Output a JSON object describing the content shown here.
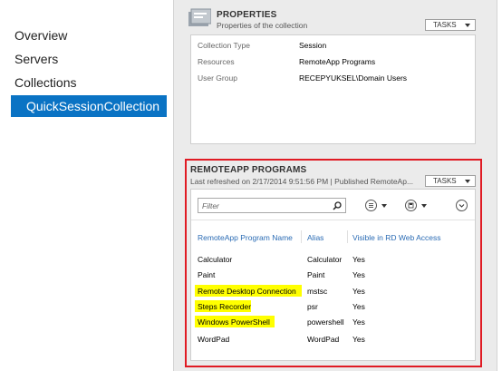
{
  "nav": {
    "items": [
      "Overview",
      "Servers",
      "Collections",
      "QuickSessionCollection"
    ],
    "selected_index": 3
  },
  "properties": {
    "title": "PROPERTIES",
    "subtitle": "Properties of the collection",
    "tasks_label": "TASKS",
    "rows": [
      {
        "label": "Collection Type",
        "value": "Session"
      },
      {
        "label": "Resources",
        "value": "RemoteApp Programs"
      },
      {
        "label": "User Group",
        "value": "RECEPYUKSEL\\Domain Users"
      }
    ]
  },
  "remoteapp": {
    "title": "REMOTEAPP PROGRAMS",
    "subtitle": "Last refreshed on 2/17/2014 9:51:56 PM | Published RemoteAp...",
    "tasks_label": "TASKS",
    "filter_placeholder": "Filter",
    "columns": [
      "RemoteApp Program Name",
      "Alias",
      "Visible in RD Web Access"
    ],
    "rows": [
      {
        "name": "Calculator",
        "alias": "Calculator",
        "visible": "Yes",
        "highlighted": false
      },
      {
        "name": "Paint",
        "alias": "Paint",
        "visible": "Yes",
        "highlighted": false
      },
      {
        "name": "Remote Desktop Connection",
        "alias": "mstsc",
        "visible": "Yes",
        "highlighted": true
      },
      {
        "name": "Steps Recorder",
        "alias": "psr",
        "visible": "Yes",
        "highlighted": true
      },
      {
        "name": "Windows PowerShell",
        "alias": "powershell",
        "visible": "Yes",
        "highlighted": true
      },
      {
        "name": "WordPad",
        "alias": "WordPad",
        "visible": "Yes",
        "highlighted": false
      }
    ],
    "annotation_color": "#e01b24",
    "highlight_color": "#ffff00"
  },
  "colors": {
    "accent": "#0a73c4",
    "header_text": "#2a6bb4"
  }
}
